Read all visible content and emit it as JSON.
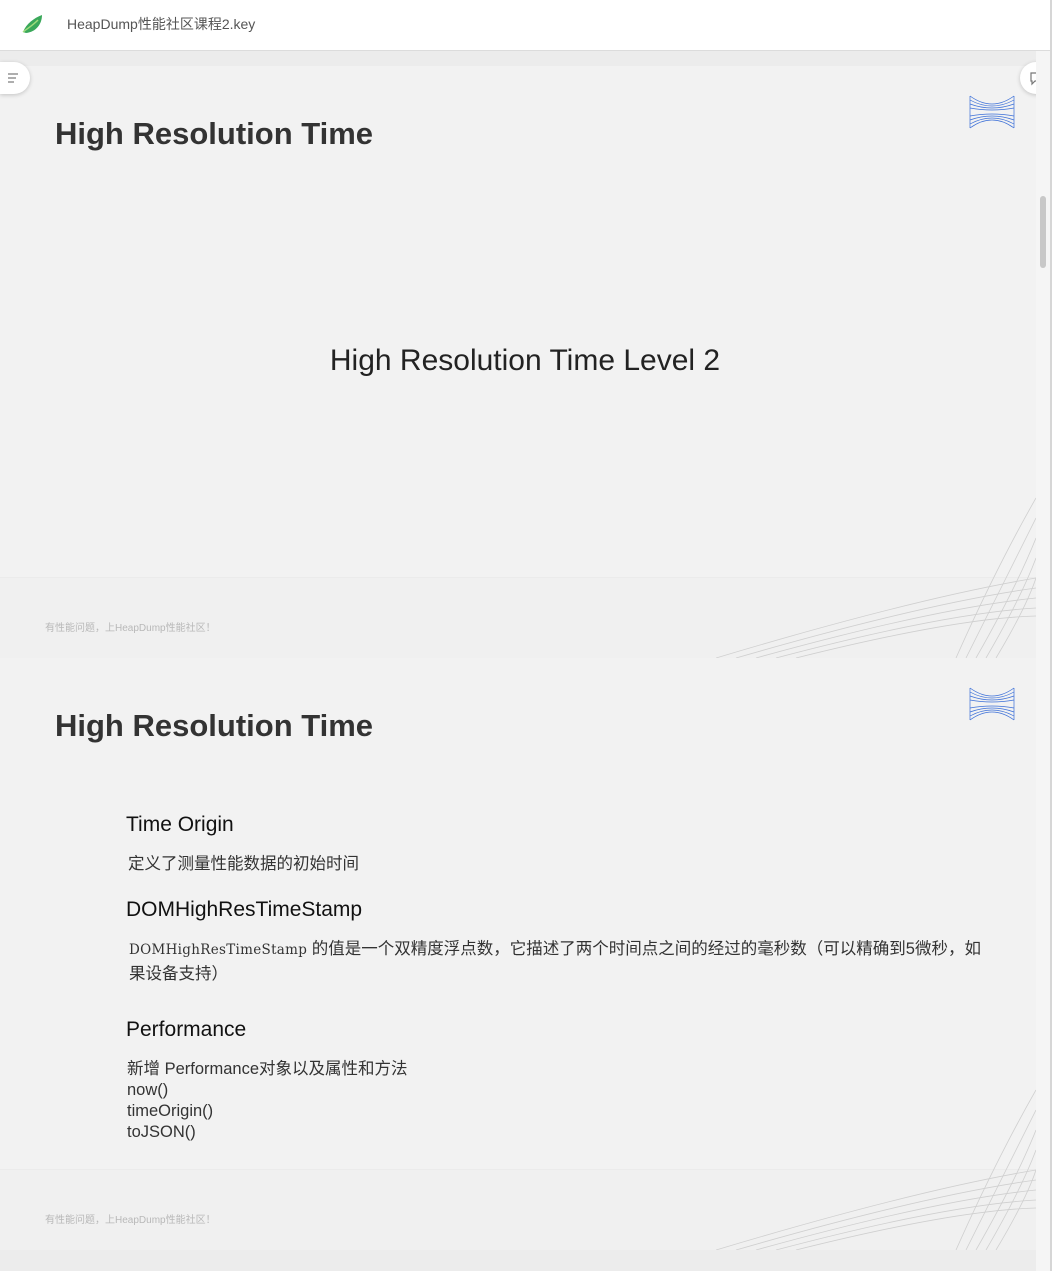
{
  "app": {
    "document_title": "HeapDump性能社区课程2.key",
    "logo_icon": "green-leaf-logo-icon"
  },
  "slides": [
    {
      "title": "High Resolution Time",
      "subtitle": "High Resolution Time Level 2",
      "footer": "有性能问题，上HeapDump性能社区！"
    },
    {
      "title": "High Resolution Time",
      "sections": [
        {
          "heading": "Time Origin",
          "text": "定义了测量性能数据的初始时间"
        },
        {
          "heading": "DOMHighResTimeStamp",
          "code": "DOMHighResTimeStamp",
          "text": " 的值是一个双精度浮点数，它描述了两个时间点之间的经过的毫秒数（可以精确到5微秒，如果设备支持）"
        },
        {
          "heading": "Performance",
          "lines": [
            "新增 Performance对象以及属性和方法",
            "now()",
            "timeOrigin()",
            "toJSON()"
          ]
        }
      ],
      "footer": "有性能问题，上HeapDump性能社区！"
    }
  ],
  "colors": {
    "accent_blue": "#3b6fd8",
    "logo_green": "#3aa85a"
  }
}
